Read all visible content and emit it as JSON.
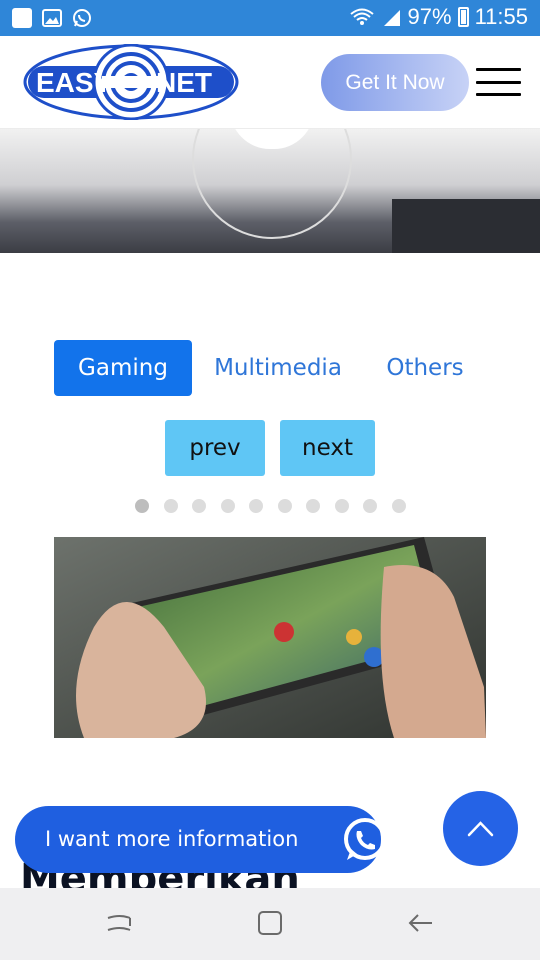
{
  "status_bar": {
    "battery": "97%",
    "time": "11:55"
  },
  "header": {
    "logo_left": "EASY",
    "logo_right": "NET",
    "cta_label": "Get It Now"
  },
  "tabs": [
    {
      "label": "Gaming",
      "active": true
    },
    {
      "label": "Multimedia",
      "active": false
    },
    {
      "label": "Others",
      "active": false
    }
  ],
  "slider": {
    "prev_label": "prev",
    "next_label": "next",
    "dot_count": 10,
    "active_dot": 1
  },
  "section_heading": "Memberikan",
  "whatsapp": {
    "label": "I want more information"
  },
  "colors": {
    "status_bar": "#2f86d8",
    "brand_blue": "#1f5fe0",
    "tab_active": "#1273eb",
    "tab_text": "#2f76d8",
    "slider_button": "#5fc6f5"
  }
}
